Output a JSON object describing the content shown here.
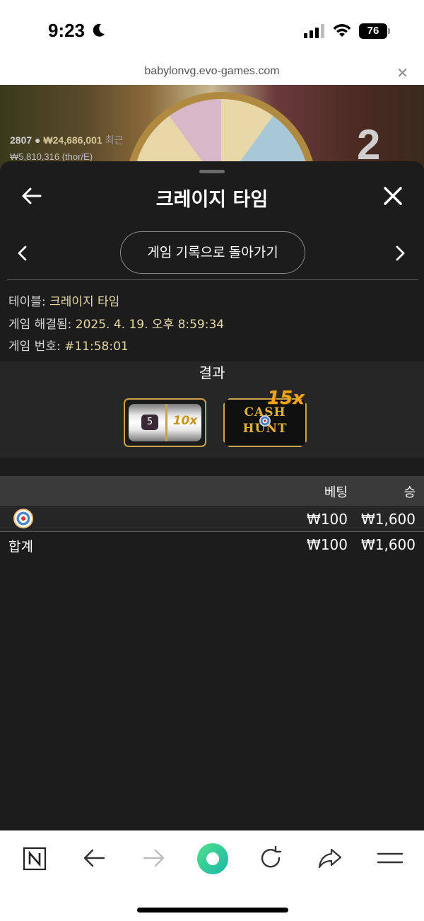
{
  "status_bar": {
    "time": "9:23",
    "battery": "76"
  },
  "url_bar": {
    "url": "babylonvg.evo-games.com"
  },
  "game_bg": {
    "player_count": "2807",
    "balance": "₩24,686,001",
    "balance_suffix": "최근",
    "sub_line": "₩5,810,316 (thor/E)",
    "round_number": "2"
  },
  "header": {
    "title": "크레이지 타임"
  },
  "nav": {
    "back_to_history_label": "게임 기록으로 돌아가기"
  },
  "info": {
    "table_label": "테이블:",
    "table_value": "크레이지 타임",
    "resolved_label": "게임 해결됨:",
    "resolved_value": "2025. 4. 19. 오후 8:59:34",
    "game_no_label": "게임 번호:",
    "game_no_value": "#11:58:01"
  },
  "result": {
    "title": "결과",
    "slot": {
      "number": "5",
      "multiplier": "10x"
    },
    "bonus": {
      "line1": "CASH",
      "line2": "HUNT",
      "multiplier": "15x"
    }
  },
  "table": {
    "headers": {
      "bet": "베팅",
      "win": "승"
    },
    "rows": [
      {
        "icon": "cash-hunt-target-icon",
        "bet": "₩100",
        "win": "₩1,600"
      }
    ],
    "total": {
      "label": "합계",
      "bet": "₩100",
      "win": "₩1,600"
    }
  },
  "colors": {
    "panel_bg": "#1c1c1c",
    "gold": "#c9a24a",
    "value_text": "#e8d9a4",
    "toolbar_accent": "#3ad46a"
  }
}
